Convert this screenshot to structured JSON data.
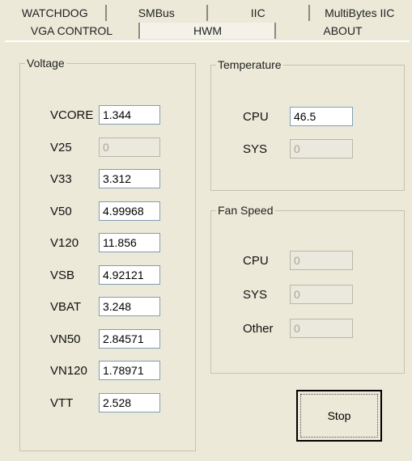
{
  "tabs_back": [
    "WATCHDOG",
    "SMBus",
    "IIC",
    "MultiBytes IIC"
  ],
  "tabs_front": [
    "VGA CONTROL",
    "HWM",
    "ABOUT"
  ],
  "active_tab": "HWM",
  "voltage": {
    "title": "Voltage",
    "rows": [
      {
        "label": "VCORE",
        "value": "1.344",
        "enabled": true
      },
      {
        "label": "V25",
        "value": "0",
        "enabled": false
      },
      {
        "label": "V33",
        "value": "3.312",
        "enabled": true
      },
      {
        "label": "V50",
        "value": "4.99968",
        "enabled": true
      },
      {
        "label": "V120",
        "value": "11.856",
        "enabled": true
      },
      {
        "label": "VSB",
        "value": "4.92121",
        "enabled": true
      },
      {
        "label": "VBAT",
        "value": "3.248",
        "enabled": true
      },
      {
        "label": "VN50",
        "value": "2.84571",
        "enabled": true
      },
      {
        "label": "VN120",
        "value": "1.78971",
        "enabled": true
      },
      {
        "label": "VTT",
        "value": "2.528",
        "enabled": true
      }
    ]
  },
  "temperature": {
    "title": "Temperature",
    "rows": [
      {
        "label": "CPU",
        "value": "46.5",
        "enabled": true
      },
      {
        "label": "SYS",
        "value": "0",
        "enabled": false
      }
    ]
  },
  "fan": {
    "title": "Fan Speed",
    "rows": [
      {
        "label": "CPU",
        "value": "0",
        "enabled": false
      },
      {
        "label": "SYS",
        "value": "0",
        "enabled": false
      },
      {
        "label": "Other",
        "value": "0",
        "enabled": false
      }
    ]
  },
  "stop_label": "Stop"
}
